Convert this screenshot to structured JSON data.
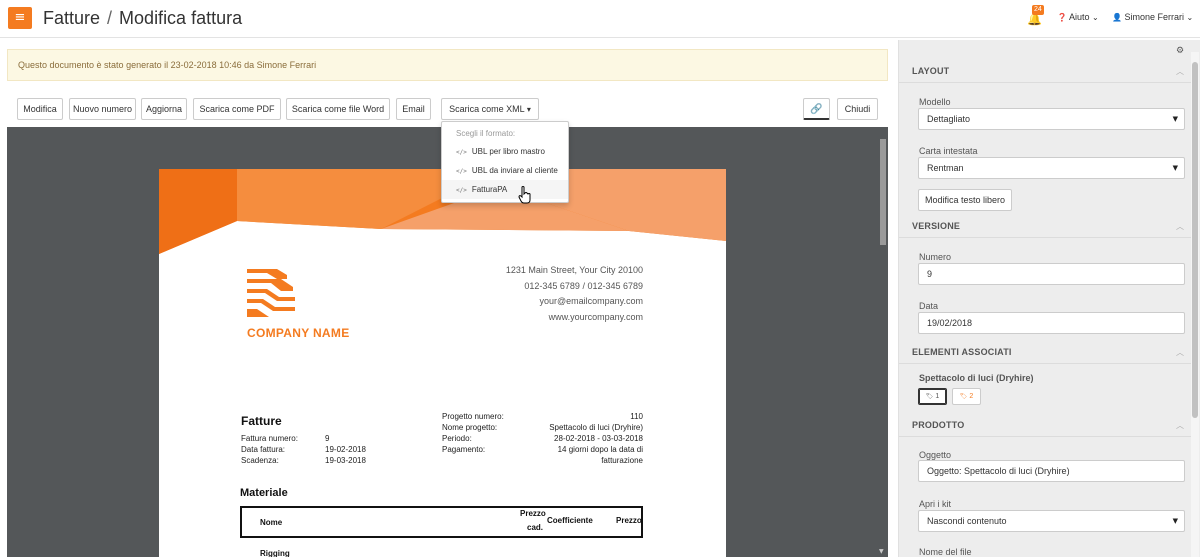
{
  "header": {
    "title": "Fatture",
    "separator": "/",
    "subtitle": "Modifica fattura",
    "notification_count": "24",
    "help_label": "Aiuto",
    "user_name": "Simone Ferrari"
  },
  "notice": {
    "text": "Questo documento è stato generato il 23-02-2018 10:46 da Simone Ferrari"
  },
  "toolbar": {
    "buttons": [
      "Modifica",
      "Nuovo numero",
      "Aggiorna",
      "Scarica come PDF",
      "Scarica come file Word",
      "Email"
    ],
    "xml_dropdown_label": "Scarica come XML",
    "close_label": "Chiudi"
  },
  "dropdown": {
    "header": "Scegli il formato:",
    "items": [
      "UBL per libro mastro",
      "UBL da inviare al cliente",
      "FatturaPA"
    ]
  },
  "invoice": {
    "address_lines": [
      "1231 Main Street, Your City 20100",
      "012-345 6789 / 012-345 6789",
      "your@emailcompany.com",
      "www.yourcompany.com"
    ],
    "company_name": "COMPANY NAME",
    "title": "Fatture",
    "left_fields": [
      {
        "label": "Fattura numero:",
        "value": "9"
      },
      {
        "label": "Data fattura:",
        "value": "19-02-2018"
      },
      {
        "label": "Scadenza:",
        "value": "19-03-2018"
      }
    ],
    "right_fields": [
      {
        "label": "Progetto numero:",
        "value": "110"
      },
      {
        "label": "Nome progetto:",
        "value": "Spettacolo di luci (Dryhire)"
      },
      {
        "label": "Periodo:",
        "value": "28-02-2018 - 03-03-2018"
      },
      {
        "label": "Pagamento:",
        "value": "14 giorni dopo la data di",
        "value2": "fatturazione"
      }
    ],
    "section_title": "Materiale",
    "table_headers": {
      "name": "Nome",
      "unit_price_1": "Prezzo",
      "unit_price_2": "cad.",
      "coefficient": "Coefficiente",
      "price": "Prezzo"
    },
    "first_row": "Rigging"
  },
  "panel": {
    "layout": {
      "title": "LAYOUT",
      "model_label": "Modello",
      "model_value": "Dettagliato",
      "letterhead_label": "Carta intestata",
      "letterhead_value": "Rentman",
      "free_text_button": "Modifica testo libero"
    },
    "version": {
      "title": "VERSIONE",
      "number_label": "Numero",
      "number_value": "9",
      "date_label": "Data",
      "date_value": "19/02/2018"
    },
    "linked": {
      "title": "ELEMENTI ASSOCIATI",
      "item_title": "Spettacolo di luci (Dryhire)",
      "tag1": "1",
      "tag2": "2"
    },
    "product": {
      "title": "PRODOTTO",
      "subject_label": "Oggetto",
      "subject_value": "Oggetto: Spettacolo di luci (Dryhire)",
      "kit_label": "Apri i kit",
      "kit_value": "Nascondi contenuto",
      "filename_label": "Nome del file"
    }
  },
  "colors": {
    "accent": "#f47b20",
    "preview_bg": "#545759",
    "notice_bg": "#fcf8e3",
    "panel_bg": "#ededed"
  }
}
